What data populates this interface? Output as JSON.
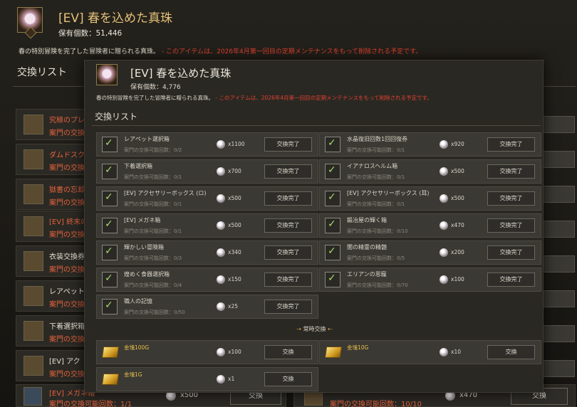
{
  "background": {
    "title": "[EV] 春を込めた真珠",
    "count": "保有個数：51,446",
    "desc_main": "春の特別冒険を完了した冒険者に贈られる真珠。",
    "desc_warning": "- このアイテムは、2026年4月第一回目の定期メンテナンスをもって削除される予定です。",
    "list_title": "交換リスト",
    "rows": [
      {
        "name": "究極のプレ",
        "sub": "案門の交換"
      },
      {
        "name": "ダムドスク",
        "sub": "案門の交換"
      },
      {
        "name": "獄書の忘却",
        "sub": "案門の交換"
      },
      {
        "name": "[EV] 終末の",
        "sub": "案門の交換"
      },
      {
        "name": "衣装交換券",
        "sub": "案門の交換"
      },
      {
        "name": "レアペット",
        "sub": "案門の交換"
      },
      {
        "name": "下着選択箱",
        "sub": "案門の交換"
      },
      {
        "name": "[EV] アク",
        "sub": "案門の交換"
      }
    ],
    "bottom_left": {
      "name": "[EV] メガネ箱",
      "sub": "案門の交換可能回数：1/1",
      "cost": "x500",
      "button": "交換"
    },
    "bottom_right": {
      "sub": "案門の交換可能回数：10/10",
      "cost": "x470",
      "button": "交換"
    }
  },
  "popup": {
    "title": "[EV] 春を込めた真珠",
    "count": "保有個数：4,776",
    "desc_main": "春の特別冒険を完了した冒険者に贈られる真珠。",
    "desc_warning": "- このアイテムは、2026年4月第一回目の定期メンテナンスをもって削除される予定です。",
    "list_title": "交換リスト",
    "items_left": [
      {
        "name": "レアペット選択箱",
        "sub": "案門の交換可能回数：0/2",
        "cost": "x1100",
        "button": "交換完了"
      },
      {
        "name": "下着選択箱",
        "sub": "案門の交換可能回数：0/1",
        "cost": "x700",
        "button": "交換完了"
      },
      {
        "name": "[EV] アクセサリーボックス (ロ)",
        "sub": "案門の交換可能回数：0/1",
        "cost": "x500",
        "button": "交換完了"
      },
      {
        "name": "[EV] メガネ箱",
        "sub": "案門の交換可能回数：0/1",
        "cost": "x500",
        "button": "交換完了"
      },
      {
        "name": "輝かしい冒険箱",
        "sub": "案門の交換可能回数：0/3",
        "cost": "x340",
        "button": "交換完了"
      },
      {
        "name": "煌めく食器選択箱",
        "sub": "案門の交換可能回数：0/4",
        "cost": "x150",
        "button": "交換完了"
      },
      {
        "name": "職人の記憶",
        "sub": "案門の交換可能回数：0/50",
        "cost": "x25",
        "button": "交換完了"
      }
    ],
    "items_right": [
      {
        "name": "水晶復旧回数1回回復券",
        "sub": "案門の交換可能回数：0/1",
        "cost": "x920",
        "button": "交換完了"
      },
      {
        "name": "イアナロスヘルム箱",
        "sub": "案門の交換可能回数：0/1",
        "cost": "x500",
        "button": "交換完了"
      },
      {
        "name": "[EV] アクセサリーボックス (耳)",
        "sub": "案門の交換可能回数：0/1",
        "cost": "x500",
        "button": "交換完了"
      },
      {
        "name": "鍛冶屋の輝く箱",
        "sub": "案門の交換可能回数：0/10",
        "cost": "x470",
        "button": "交換完了"
      },
      {
        "name": "闇の精霊の精髄",
        "sub": "案門の交換可能回数：0/5",
        "cost": "x200",
        "button": "交換完了"
      },
      {
        "name": "エリアンの恩寵",
        "sub": "案門の交換可能回数：0/70",
        "cost": "x100",
        "button": "交換完了"
      }
    ],
    "permanent_label": "常時交換",
    "permanent_items": [
      {
        "name": "金塊100G",
        "cost": "x100",
        "button": "交換"
      },
      {
        "name": "金塊10G",
        "cost": "x10",
        "button": "交換"
      },
      {
        "name": "金塊1G",
        "cost": "x1",
        "button": "交換"
      }
    ]
  }
}
